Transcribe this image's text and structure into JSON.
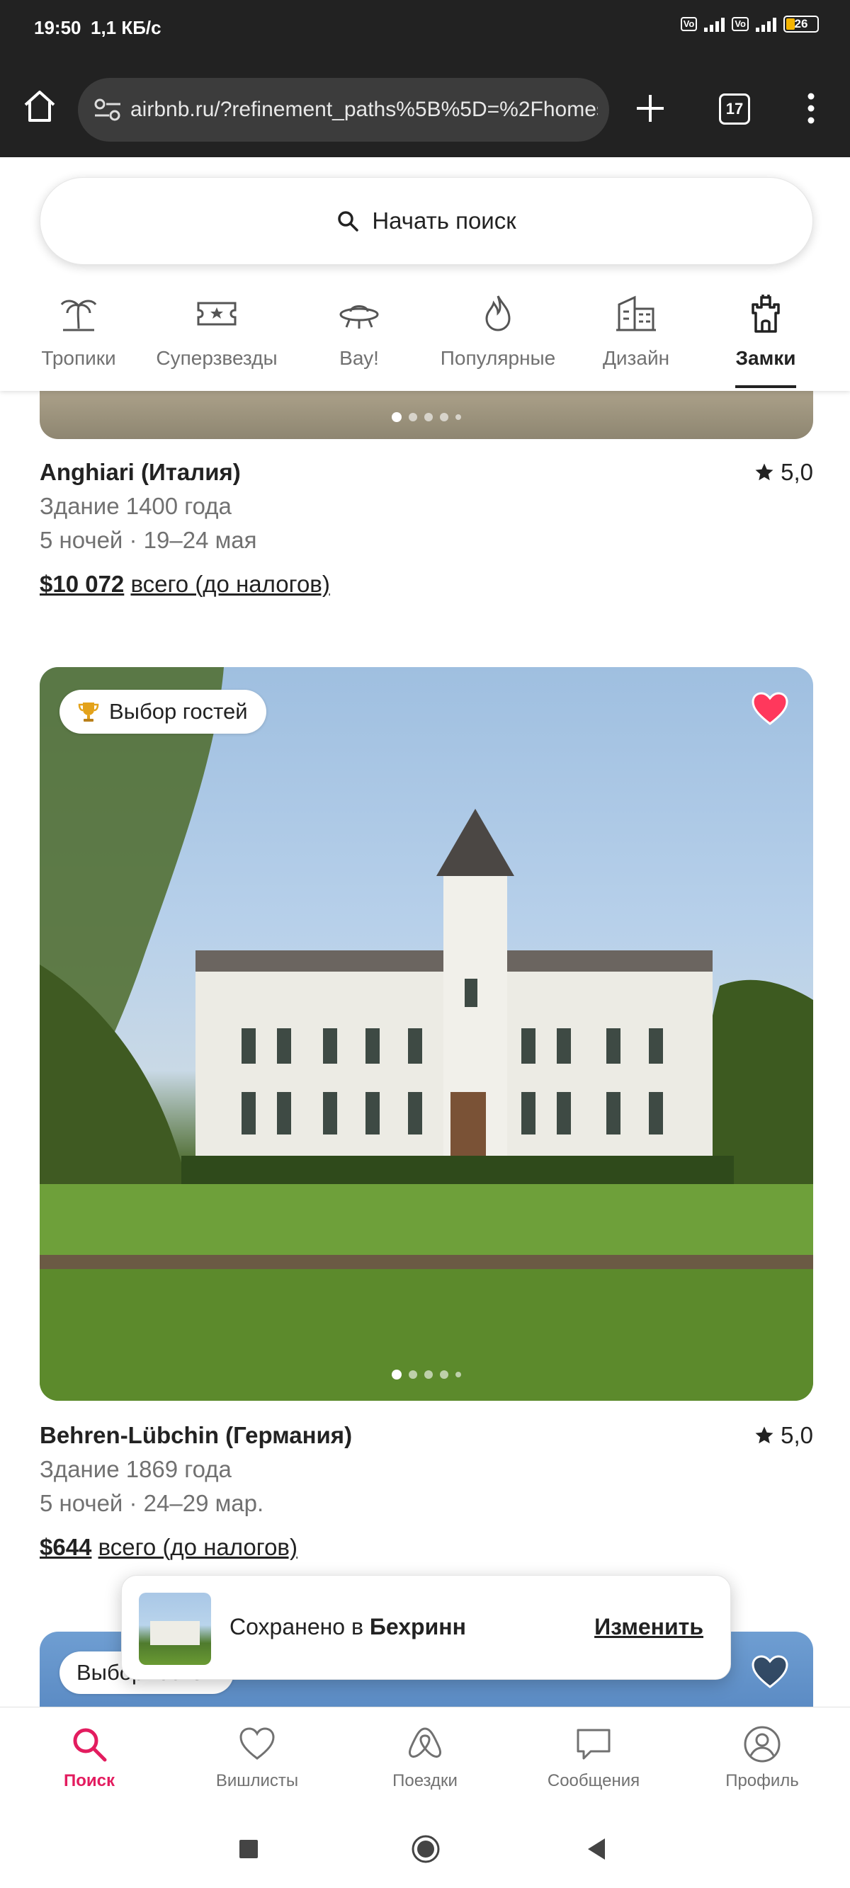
{
  "status_bar": {
    "time": "19:50",
    "speed": "1,1 КБ/с",
    "volte": "Vo LTE",
    "network": "4G",
    "battery": "26"
  },
  "browser": {
    "url": "airbnb.ru/?refinement_paths%5B%5D=%2Fhomes",
    "tab_count": "17"
  },
  "search": {
    "label": "Начать поиск"
  },
  "categories": [
    {
      "label": "Тропики",
      "icon": "palm-tree-icon"
    },
    {
      "label": "Суперзвезды",
      "icon": "ticket-star-icon"
    },
    {
      "label": "Вау!",
      "icon": "ufo-icon"
    },
    {
      "label": "Популярные",
      "icon": "flame-icon"
    },
    {
      "label": "Дизайн",
      "icon": "building-icon"
    },
    {
      "label": "Замки",
      "icon": "castle-icon",
      "active": true
    }
  ],
  "listings": [
    {
      "title": "Anghiari (Италия)",
      "rating": "5,0",
      "subtitle": "Здание 1400 года",
      "dates": "5 ночей · 19–24 мая",
      "price": "$10 072",
      "price_suffix": "всего (до налогов)"
    },
    {
      "badge": "Выбор гостей",
      "title": "Behren-Lübchin (Германия)",
      "rating": "5,0",
      "subtitle": "Здание 1869 года",
      "dates": "5 ночей · 24–29 мар.",
      "price": "$644",
      "price_suffix": "всего (до налогов)",
      "favorited": true
    },
    {
      "badge": "Выбор гостей"
    }
  ],
  "toast": {
    "prefix": "Сохранено в",
    "wishlist": "Бехринн",
    "action": "Изменить"
  },
  "bottom_nav": [
    {
      "label": "Поиск",
      "icon": "search-icon",
      "active": true
    },
    {
      "label": "Вишлисты",
      "icon": "heart-icon"
    },
    {
      "label": "Поездки",
      "icon": "airbnb-logo-icon"
    },
    {
      "label": "Сообщения",
      "icon": "message-icon"
    },
    {
      "label": "Профиль",
      "icon": "profile-icon"
    }
  ],
  "colors": {
    "accent": "#e31c5f",
    "text": "#222222",
    "muted": "#717171",
    "heart_fill": "#ff385c"
  }
}
